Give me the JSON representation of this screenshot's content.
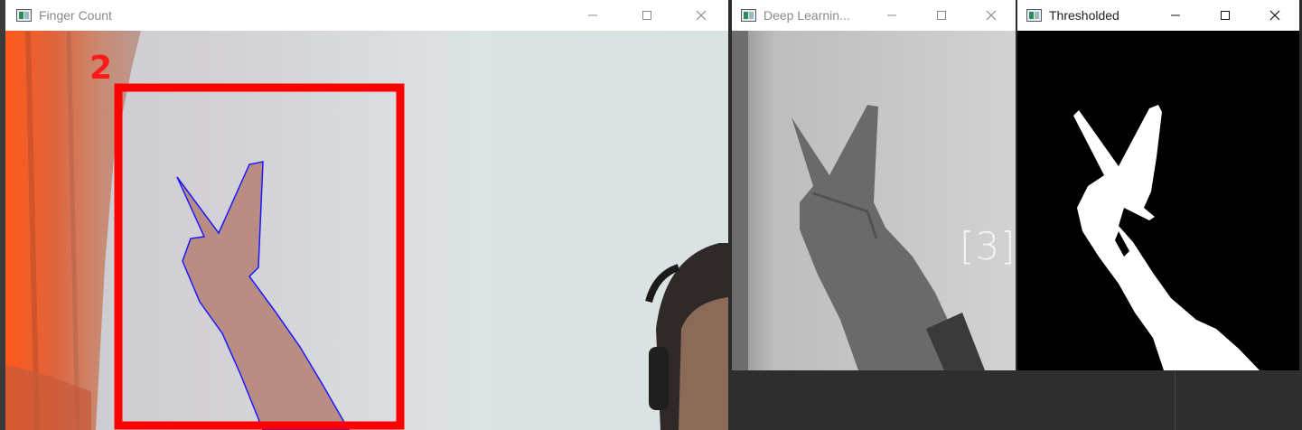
{
  "windows": {
    "finger_count": {
      "title": "Finger Count",
      "finger_count_label": "2"
    },
    "deep_learning": {
      "title": "Deep Learnin...",
      "prediction_label": "[3]"
    },
    "thresholded": {
      "title": "Thresholded"
    }
  },
  "colors": {
    "roi_box": "#ff0000",
    "hand_contour": "#1a1aff",
    "count_text": "#ff1a1a"
  }
}
